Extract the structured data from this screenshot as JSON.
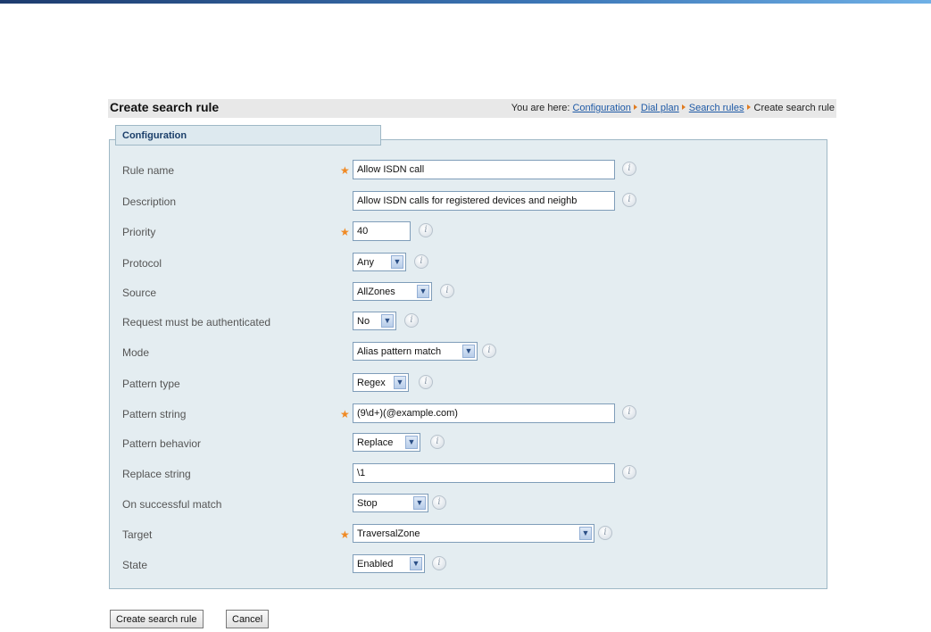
{
  "header": {
    "title": "Create search rule",
    "breadcrumb_prefix": "You are here:",
    "crumbs": [
      "Configuration",
      "Dial plan",
      "Search rules"
    ],
    "current": "Create search rule"
  },
  "panel": {
    "title": "Configuration"
  },
  "fields": {
    "rule_name": {
      "label": "Rule name",
      "value": "Allow ISDN call",
      "required": "★"
    },
    "description": {
      "label": "Description",
      "value": "Allow ISDN calls for registered devices and neighb"
    },
    "priority": {
      "label": "Priority",
      "value": "40",
      "required": "★"
    },
    "protocol": {
      "label": "Protocol",
      "value": "Any"
    },
    "source": {
      "label": "Source",
      "value": "AllZones"
    },
    "auth": {
      "label": "Request must be authenticated",
      "value": "No"
    },
    "mode": {
      "label": "Mode",
      "value": "Alias pattern match"
    },
    "pattern_type": {
      "label": "Pattern type",
      "value": "Regex"
    },
    "pattern_string": {
      "label": "Pattern string",
      "value": "(9\\d+)(@example.com)",
      "required": "★"
    },
    "pattern_behavior": {
      "label": "Pattern behavior",
      "value": "Replace"
    },
    "replace_string": {
      "label": "Replace string",
      "value": "\\1"
    },
    "on_match": {
      "label": "On successful match",
      "value": "Stop"
    },
    "target": {
      "label": "Target",
      "value": "TraversalZone",
      "required": "★"
    },
    "state": {
      "label": "State",
      "value": "Enabled"
    }
  },
  "icons": {
    "info": "i",
    "dropdown": "▼"
  },
  "buttons": {
    "create": "Create search rule",
    "cancel": "Cancel"
  }
}
